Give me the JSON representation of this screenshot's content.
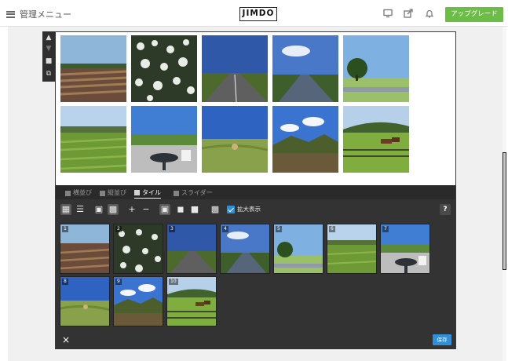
{
  "topbar": {
    "menu_label": "管理メニュー",
    "logo": "JIMDO",
    "upgrade_label": "アップグレード"
  },
  "tabs": [
    {
      "label": "横並び"
    },
    {
      "label": "縦並び"
    },
    {
      "label": "タイル"
    },
    {
      "label": "スライダー"
    }
  ],
  "toolbar": {
    "zoom_label": "拡大表示",
    "help_label": "?"
  },
  "thumbnails": [
    {
      "num": "1"
    },
    {
      "num": "2"
    },
    {
      "num": "3"
    },
    {
      "num": "4"
    },
    {
      "num": "5"
    },
    {
      "num": "6"
    },
    {
      "num": "7"
    },
    {
      "num": "8"
    },
    {
      "num": "9"
    },
    {
      "num": "10"
    }
  ],
  "footer": {
    "close_label": "×",
    "save_label": "保存"
  },
  "colors": {
    "accent_green": "#6bbd45",
    "accent_blue": "#2f8fd8",
    "panel_dark": "#333333"
  }
}
